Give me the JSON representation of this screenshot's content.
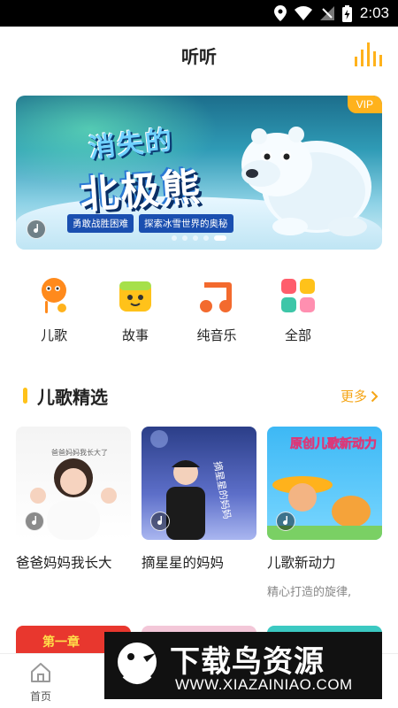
{
  "status_bar": {
    "time": "2:03"
  },
  "header": {
    "title": "听听",
    "right_icon": "equalizer-icon"
  },
  "banner": {
    "title_line1": "消失的",
    "title_line2": "北极熊",
    "tags": [
      "勇敢战胜困难",
      "探索冰雪世界的奥秘"
    ],
    "badge": "VIP",
    "active_dot": 4,
    "dot_count": 5
  },
  "categories": [
    {
      "label": "儿歌",
      "icon": "kids-song-icon",
      "color": "#ff8a1c"
    },
    {
      "label": "故事",
      "icon": "story-icon",
      "color": "#ffc21a"
    },
    {
      "label": "纯音乐",
      "icon": "music-note-icon",
      "color": "#f36a2e"
    },
    {
      "label": "全部",
      "icon": "all-grid-icon",
      "color": "#ff5d6c"
    }
  ],
  "section": {
    "title": "儿歌精选",
    "more": "更多"
  },
  "albums": [
    {
      "name": "爸爸妈妈我长大",
      "desc": "",
      "cover_text": "爸爸妈妈我长大了"
    },
    {
      "name": "摘星星的妈妈",
      "desc": "",
      "cover_text": "摘星星的妈妈"
    },
    {
      "name": "儿歌新动力",
      "desc": "精心打造的旋律,",
      "cover_text": "原创儿歌新动力"
    }
  ],
  "peek_cards": [
    {
      "text": "第一章"
    }
  ],
  "bottom_nav": {
    "home": "首页"
  },
  "watermark": {
    "text": "下载鸟资源",
    "url": "WWW.XIAZAINIAO.COM"
  },
  "colors": {
    "accent": "#ffc21a",
    "more": "#f5a516",
    "vip": "#ffb21c"
  }
}
